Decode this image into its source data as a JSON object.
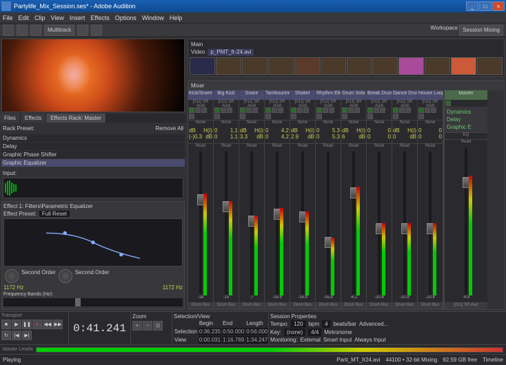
{
  "titlebar": {
    "title": "Partylife_Mix_Session.ses* - Adobe Audition"
  },
  "menu": [
    "File",
    "Edit",
    "Clip",
    "View",
    "Insert",
    "Effects",
    "Options",
    "Window",
    "Help"
  ],
  "toolbar": {
    "mode": "Multitrack"
  },
  "workspace": {
    "label": "Workspace",
    "preset": "Session Mixing"
  },
  "left_tabs": [
    "Files",
    "Effects",
    "Effects Rack: Master"
  ],
  "fx_rack": {
    "preset_label": "Rack Preset:",
    "remove": "Remove All",
    "title": "Effect 1: Filters\\Parametric Equalizer",
    "effect_preset_label": "Effect Preset:",
    "effect_preset": "Full Reset",
    "items": [
      "Dynamics",
      "Delay",
      "Graphic Phase Shifter",
      "Graphic Equalizer"
    ],
    "order1": "Second Order",
    "order2": "Second Order",
    "hz1": "1172 Hz",
    "hz2": "1172 Hz",
    "freq_bands": "Frequency Bands (Hz):",
    "input_label": "Input:"
  },
  "timeline": {
    "panel": "Main",
    "video_label": "Video",
    "clip": "p_PMT_fr-24.avi"
  },
  "mixer": {
    "panel": "Mixer",
    "track_sub": "[011] SR Audi",
    "insert": "None",
    "read": "Read",
    "out": "Drum Bus",
    "out_master": "[011] SR Aud",
    "tracks": [
      {
        "name": "Kick/Snare L",
        "db": -18.0,
        "r1": "dB",
        "r2": "H(i)",
        "r3": "(-)0.3",
        "r4": "dB",
        "meter": 70,
        "fader": 30
      },
      {
        "name": "Big Kick",
        "db": -15.0,
        "r1": "0",
        "r2": "1.1",
        "r3": "0",
        "r4": "1.1",
        "meter": 65,
        "fader": 35
      },
      {
        "name": "Snare",
        "db": -7.0,
        "r1": "dB",
        "r2": "H(i)",
        "r3": "3.3",
        "r4": "dB",
        "meter": 55,
        "fader": 45
      },
      {
        "name": "Tambourine",
        "db": -16.9,
        "r1": "0",
        "r2": "4.2",
        "r3": "0",
        "r4": "4.2",
        "meter": 60,
        "fader": 40
      },
      {
        "name": "Shaker",
        "db": -16.9,
        "r1": "dB",
        "r2": "H(i)",
        "r3": "2.9",
        "r4": "dB",
        "meter": 58,
        "fader": 42
      },
      {
        "name": "Rhythm Ele",
        "db": -35.8,
        "r1": "0",
        "r2": "5.3",
        "r3": "0",
        "r4": "5.3",
        "meter": 40,
        "fader": 60
      },
      {
        "name": "Drum Solo",
        "db": -6.2,
        "r1": "dB",
        "r2": "H(i)",
        "r3": "6",
        "r4": "dB",
        "meter": 75,
        "fader": 25
      },
      {
        "name": "Break Drum",
        "db": -20.8,
        "r1": "0",
        "r2": "0",
        "r3": "0",
        "r4": "0",
        "meter": 50,
        "fader": 50
      },
      {
        "name": "Dance Drum",
        "db": -20.8,
        "r1": "dB",
        "r2": "H(i)",
        "r3": "0",
        "r4": "dB",
        "meter": 50,
        "fader": 50
      },
      {
        "name": "House Loop",
        "db": -20.8,
        "r1": "0",
        "r2": "0",
        "r3": "0",
        "r4": "0",
        "meter": 50,
        "fader": 50
      }
    ],
    "master": {
      "name": "Master",
      "db": -4.9,
      "fx": [
        "Dynamics",
        "Delay",
        "Graphic E"
      ],
      "eq": "EQ",
      "read": "Read"
    }
  },
  "transport": {
    "title": "Transport",
    "time": "0:41.241",
    "zoom": "Zoom",
    "selview": {
      "title": "Selection/View",
      "begin": "Begin",
      "end": "End",
      "length": "Length",
      "sel": [
        "Selection",
        "0:36.235",
        "0:50.000",
        "0:56.000"
      ],
      "view": [
        "View",
        "0:00.031",
        "1:16.769",
        "1:34.247"
      ]
    }
  },
  "session": {
    "title": "Session Properties",
    "tempo_label": "Tempo:",
    "tempo": "120",
    "bpm": "bpm",
    "beats": "4",
    "beatbar": "beats/bar",
    "adv": "Advanced...",
    "key_label": "Key:",
    "key": "(none)",
    "time_label": "4/4",
    "metro": "Metronome",
    "mon_label": "Monitoring:",
    "mon1": "External",
    "mon2": "Smart Input",
    "mon3": "Always Input"
  },
  "master_levels": "Master Levels",
  "status": {
    "state": "Playing",
    "disk": "44100 • 32-bit Mixing",
    "file": "Parti_MT_fr24.avi",
    "free": "92.59 GB free",
    "tc": "Timeline"
  }
}
